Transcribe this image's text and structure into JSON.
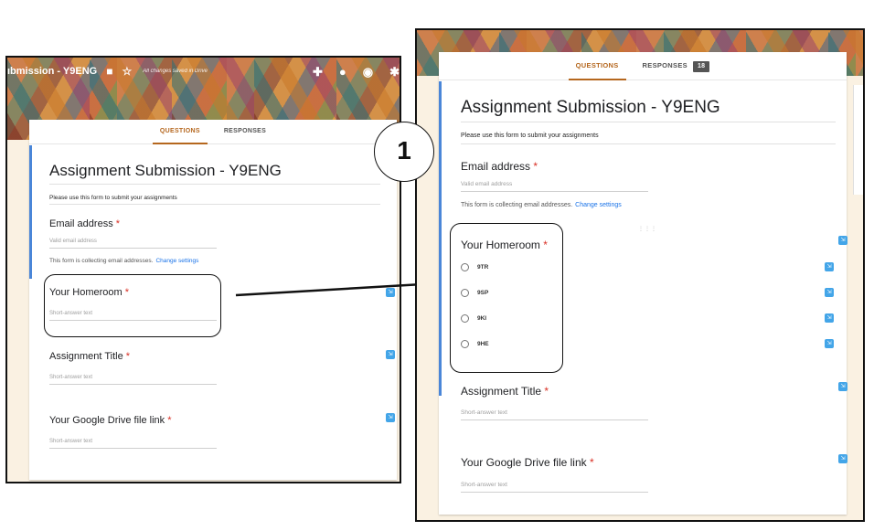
{
  "left": {
    "form_title_truncated": "ıbmission - Y9ENG",
    "saved_text": "All changes saved in Drive",
    "tabs": {
      "questions": "QUESTIONS",
      "responses": "RESPONSES"
    },
    "form_title": "Assignment Submission - Y9ENG",
    "description": "Please use this form to submit your assignments",
    "email": {
      "label": "Email address",
      "required": "*",
      "placeholder": "Valid email address",
      "note": "This form is collecting email addresses.",
      "settings_link": "Change settings"
    },
    "questions": [
      {
        "label": "Your Homeroom",
        "required": "*",
        "placeholder": "Short-answer text"
      },
      {
        "label": "Assignment Title",
        "required": "*",
        "placeholder": "Short-answer text"
      },
      {
        "label": "Your Google Drive file link",
        "required": "*",
        "placeholder": "Short-answer text"
      }
    ]
  },
  "right": {
    "tabs": {
      "questions": "QUESTIONS",
      "responses": "RESPONSES",
      "responses_count": "18"
    },
    "form_title": "Assignment Submission - Y9ENG",
    "description": "Please use this form to submit your assignments",
    "email": {
      "label": "Email address",
      "required": "*",
      "placeholder": "Valid email address",
      "note": "This form is collecting email addresses.",
      "settings_link": "Change settings"
    },
    "homeroom": {
      "label": "Your Homeroom",
      "required": "*",
      "options": [
        "9TR",
        "9SP",
        "9KI",
        "9HE"
      ]
    },
    "questions": [
      {
        "label": "Assignment Title",
        "required": "*",
        "placeholder": "Short-answer text"
      },
      {
        "label": "Your Google Drive file link",
        "required": "*",
        "placeholder": "Short-answer text"
      }
    ]
  },
  "callout_number": "1",
  "colors": {
    "accent": "#b5671e",
    "link": "#1a73e8",
    "required": "#d93025",
    "left_bar": "#4a86d8"
  },
  "icons": [
    "folder-icon",
    "star-icon",
    "addon-icon",
    "palette-icon",
    "preview-icon",
    "settings-icon",
    "drag-handle-icon",
    "question-type-icon",
    "radio-icon"
  ]
}
